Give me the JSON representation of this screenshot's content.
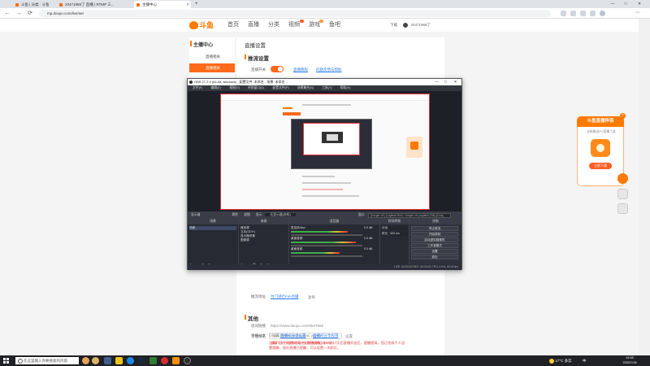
{
  "browser": {
    "tabs": [
      {
        "label": "斗鱼 | 分类 · 斗鱼",
        "active": false
      },
      {
        "label": "20471968了 直播 | RTMP 三...",
        "active": false
      },
      {
        "label": "主播中心",
        "active": true
      }
    ],
    "new_tab": "+",
    "url": "mp.douyu.com/live/set",
    "window_controls": [
      "—",
      "□",
      "✕"
    ],
    "nav": {
      "back": "←",
      "forward": "→",
      "reload": "⟳"
    }
  },
  "site": {
    "logo_text": "斗鱼",
    "nav": [
      "首页",
      "直播",
      "分类",
      "视频",
      "游戏",
      "鱼吧"
    ],
    "header_right": {
      "download": "下载",
      "username": "20471968了"
    }
  },
  "sidebar": {
    "title": "主播中心",
    "items": [
      {
        "label": "直播相关",
        "active": false
      },
      {
        "label": "直播相关",
        "active": true
      }
    ]
  },
  "main": {
    "page_title": "直播设置",
    "section_stream": "推流设置",
    "live_switch_label": "直播开关",
    "live_switch_links": [
      "直播教程",
      "问题反馈与帮助"
    ],
    "addr_label": "推流地址",
    "addr_link": "为门进行mm点播",
    "addr_suffix": "复制",
    "section_other": "其他",
    "room_link_label": "房间链接",
    "room_link_value": "https://www.douyu.com/5537552",
    "custom_label": "个性域名",
    "custom_value": "https://www.douyu.com/ yuyoo",
    "custom_btn": "设置",
    "custom_note": "请填写5 - 7位数字域名与字符串组成一位",
    "privacy_label": "直播分享",
    "privacy_value": "§ 设置",
    "privacy_links": [
      "直播间分享设置",
      "直播间分享权限"
    ],
    "warning": "注意：已完成的30天一位量播放数，2022年7天后直播开启后，提醒提高。您已完成个人设置提醒，现在直播已提醒，可以设置一次即可。"
  },
  "obs": {
    "title": "OBS 27.2.4 (64-bit, windows) - 配置文件: 未命名 - 场景: 未命名",
    "window_controls": [
      "—",
      "□",
      "✕"
    ],
    "menu": [
      "文件(F)",
      "编辑(E)",
      "视图(V)",
      "停靠窗口(D)",
      "配置文件(P)",
      "场景集合(S)",
      "工具(T)",
      "帮助(H)"
    ],
    "context_bar": {
      "source_label": "显示器",
      "props_btn": "属性",
      "filters_btn": "滤镜",
      "display_label": "显示",
      "display_value": "无显示器(未知)",
      "capture_label": "窗口",
      "capture_value": "[Google: x5 ] (Logitech Brio) : Google: x5 (Logitech (TM)) [Crop]"
    },
    "docks": {
      "scenes": {
        "title": "场景",
        "items": [
          "场景"
        ],
        "footer": "+ − ∧ ∨"
      },
      "sources": {
        "title": "来源",
        "items": [
          "媒体源",
          "文本(GDI+)",
          "显示器采集",
          "图像源"
        ],
        "footer": "+ − ⚙ ∧ ∨"
      },
      "mixer": {
        "title": "混音器",
        "channels": [
          {
            "name": "麦克风/Aux",
            "db": "0.0 dB"
          },
          {
            "name": "桌面音频",
            "db": "0.0 dB"
          },
          {
            "name": "桌面音频",
            "db": "0.0 dB"
          }
        ]
      },
      "transitions": {
        "title": "转场特效",
        "type": "淡出",
        "duration_label": "时长",
        "duration_value": "300 ms"
      },
      "controls": {
        "title": "控制",
        "buttons": [
          "停止推流",
          "开始录制",
          "启动虚拟摄像机",
          "工作室模式",
          "设置",
          "退出"
        ]
      }
    },
    "status": "LIVE: 00:00:00   REC: 00:00:00   CPU: 4.9%, 60.00 fps"
  },
  "promo": {
    "title": "斗鱼直播伴侣",
    "subtitle": "全新推出PC直播工具",
    "button": "立即下载",
    "close": "×"
  },
  "taskbar": {
    "search_placeholder": "在这里输入你要搜索的内容",
    "weather": "17°C 多云",
    "tray_lang": "中",
    "time": "19:45",
    "date": "2022/7/18"
  },
  "colors": {
    "accent": "#ff6a1a",
    "obs_bg": "#2b2e38",
    "link": "#2b7de9",
    "warning": "#e23b3b"
  }
}
